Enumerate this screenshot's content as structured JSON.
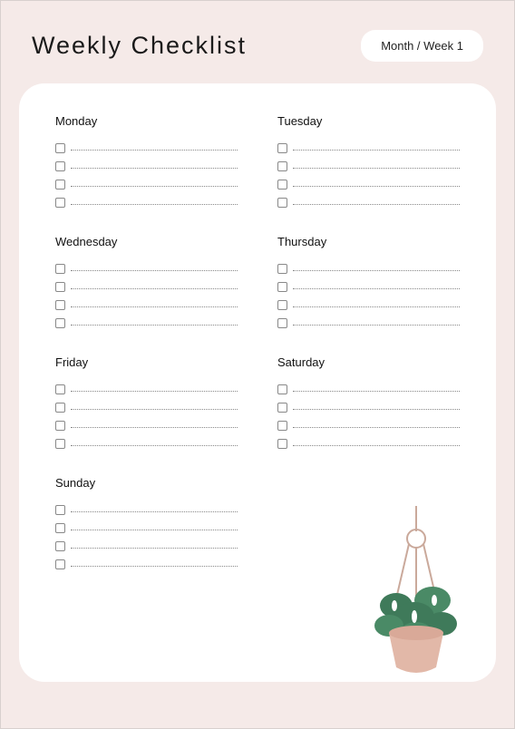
{
  "header": {
    "title": "Weekly Checklist",
    "month_label": "Month / Week 1"
  },
  "days": [
    {
      "label": "Monday"
    },
    {
      "label": "Tuesday"
    },
    {
      "label": "Wednesday"
    },
    {
      "label": "Thursday"
    },
    {
      "label": "Friday"
    },
    {
      "label": "Saturday"
    },
    {
      "label": "Sunday"
    }
  ],
  "rows_per_day": 4,
  "decoration": {
    "name": "hanging-plant"
  }
}
